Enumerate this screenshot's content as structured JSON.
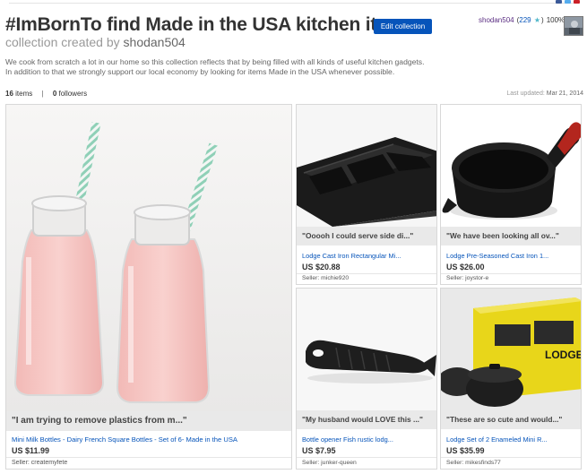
{
  "header": {
    "title": "#ImBornTo find Made in the USA kitchen items",
    "edit_button": "Edit collection",
    "subtitle_prefix": "collection created by",
    "creator": "shodan504"
  },
  "user": {
    "name": "shodan504",
    "score_open": "(",
    "score": "229",
    "star": "★",
    "score_close": ")",
    "positive": "100%"
  },
  "description": "We cook from scratch a lot in our home so this collection reflects that by being filled with all kinds of useful kitchen gadgets. In addition to that we strongly support our local economy by looking for items Made in the USA whenever possible.",
  "stats": {
    "items_count": "16",
    "items_label": "items",
    "separator": "|",
    "followers_count": "0",
    "followers_label": "followers",
    "last_updated_label": "Last updated:",
    "last_updated_date": "Mar 21, 2014"
  },
  "items": [
    {
      "quote": "\"I am trying to remove plastics from m...\"",
      "title": "Mini Milk Bottles - Dairy French Square Bottles - Set of 6- Made in the USA",
      "price": "US $11.99",
      "seller_label": "Seller:",
      "seller": "createmyfete"
    },
    {
      "quote": "\"Ooooh I could serve side di...\"",
      "title": "Lodge Cast Iron Rectangular Mi...",
      "price": "US $20.88",
      "seller_label": "Seller:",
      "seller": "michie920"
    },
    {
      "quote": "\"We have been looking all ov...\"",
      "title": "Lodge Pre-Seasoned Cast Iron 1...",
      "price": "US $26.00",
      "seller_label": "Seller:",
      "seller": "joystor-e"
    },
    {
      "quote": "\"My husband would LOVE this ...\"",
      "title": "Bottle opener Fish rustic lodg...",
      "price": "US $7.95",
      "seller_label": "Seller:",
      "seller": "junker-queen"
    },
    {
      "quote": "\"These are so cute and would...\"",
      "title": "Lodge Set of 2 Enameled Mini R...",
      "price": "US $35.99",
      "seller_label": "Seller:",
      "seller": "mikesfinds77"
    }
  ],
  "image_text": {
    "box_brand": "LODGE"
  },
  "colors": {
    "primary_button": "#0654ba",
    "link": "#0654ba",
    "username": "#5a2d82",
    "quote_bg": "#e9e9e9",
    "milk": "#f6c7c4",
    "straw": "#8fd0b7",
    "cast_iron": "#1c1c1c",
    "handle_red": "#b3261e",
    "box_yellow": "#e8d61a"
  },
  "icons": {
    "star": "star-icon",
    "share": [
      "facebook-icon",
      "twitter-icon",
      "pinterest-icon"
    ]
  }
}
